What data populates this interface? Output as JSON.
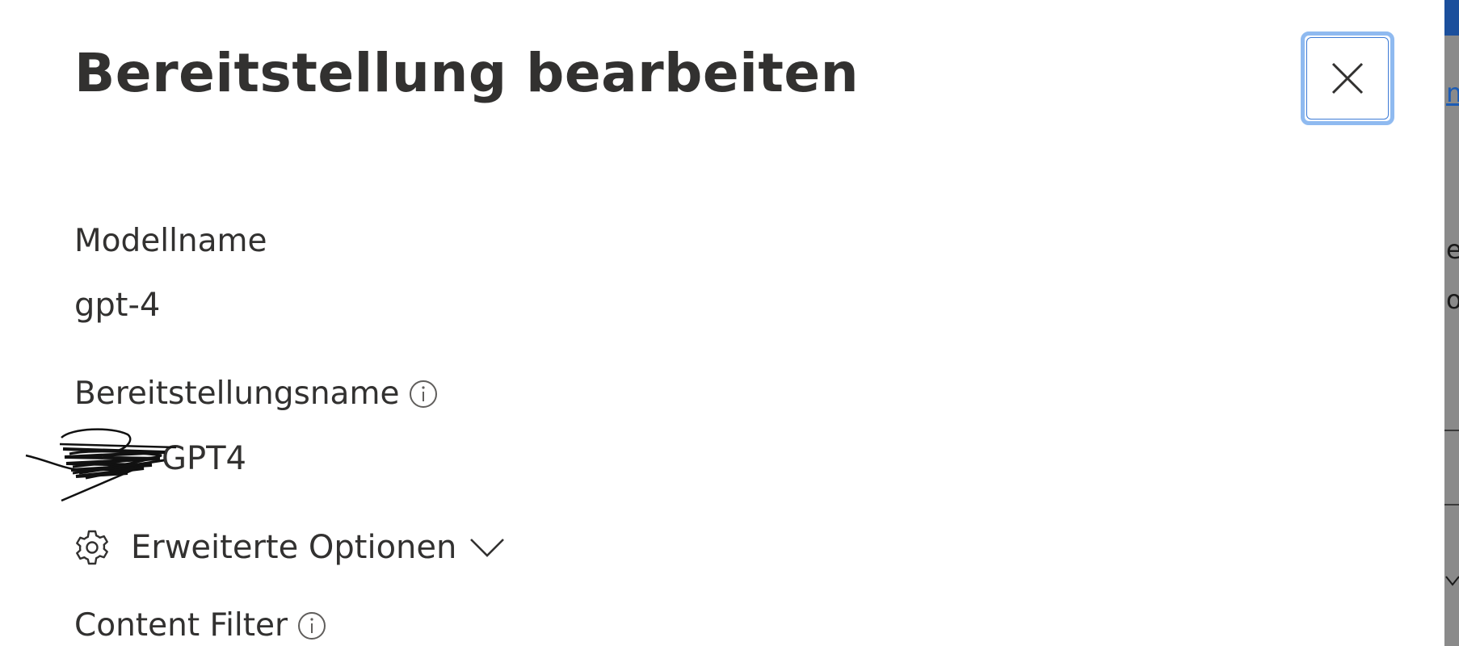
{
  "dialog": {
    "title": "Bereitstellung bearbeiten",
    "close_icon": "close-icon"
  },
  "fields": {
    "model_name": {
      "label": "Modellname",
      "value": "gpt-4"
    },
    "deployment_name": {
      "label": "Bereitstellungsname",
      "info_icon": "info-icon",
      "value": "GPT4"
    },
    "advanced_options": {
      "label": "Erweiterte Optionen",
      "icon": "gear-icon",
      "chevron": "chevron-down-icon"
    },
    "content_filter": {
      "label": "Content Filter",
      "info_icon": "info-icon"
    }
  },
  "colors": {
    "text": "#323130",
    "focus_border": "#8fbaf0",
    "backdrop_bar": "#1b4f9c"
  }
}
